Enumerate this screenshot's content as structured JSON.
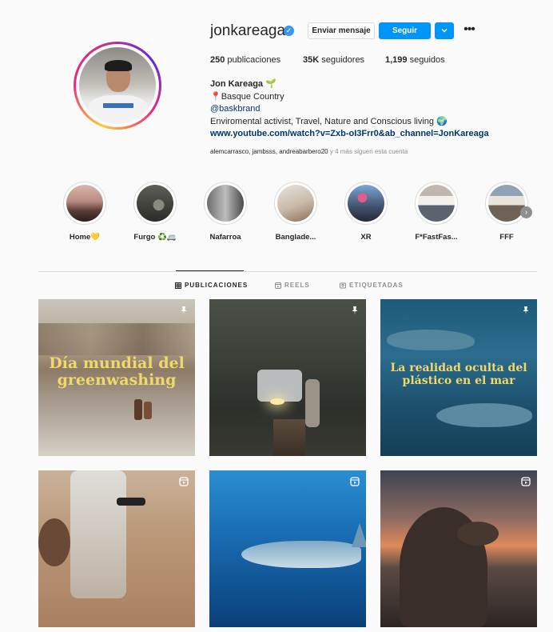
{
  "profile": {
    "username": "jonkareaga",
    "verified_mark": "✓",
    "message_label": "Enviar mensaje",
    "follow_label": "Seguir",
    "caret": "⌄",
    "more": "•••",
    "stats": {
      "posts_count": "250",
      "posts_label": " publicaciones",
      "followers_count": "35K",
      "followers_label": " seguidores",
      "following_count": "1,199",
      "following_label": " seguidos"
    },
    "bio": {
      "name": "Jon Kareaga",
      "name_emoji": "🌱",
      "location": "📍Basque Country",
      "brand": "@baskbrand",
      "description": "Enviromental activist, Travel, Nature and Conscious living 🌍",
      "link": "www.youtube.com/watch?v=Zxb-oI3Frr0&ab_channel=JonKareaga"
    },
    "followed_by": {
      "names": "alemcarrasco, jambsss, andreabarbero20",
      "suffix": " y 4 más siguen esta cuenta"
    }
  },
  "highlights": [
    {
      "label": "Home💛"
    },
    {
      "label": "Furgo ♻️🚐"
    },
    {
      "label": "Nafarroa"
    },
    {
      "label": "Banglade..."
    },
    {
      "label": "XR"
    },
    {
      "label": "F*FastFas..."
    },
    {
      "label": "FFF"
    }
  ],
  "highlights_next_arrow": "›",
  "tabs": {
    "posts": "PUBLICACIONES",
    "reels": "REELS",
    "tagged": "ETIQUETADAS"
  },
  "posts": [
    {
      "overlay": "Día mundial del greenwashing",
      "corner_icon": "pin-icon"
    },
    {
      "overlay": "",
      "corner_icon": "pin-icon"
    },
    {
      "overlay": "La realidad oculta del plástico en el mar",
      "corner_icon": "pin-icon"
    },
    {
      "overlay": "",
      "corner_icon": "reel-icon"
    },
    {
      "overlay": "",
      "corner_icon": "reel-icon"
    },
    {
      "overlay": "",
      "corner_icon": "reel-icon"
    }
  ],
  "colors": {
    "accent": "#0095f6",
    "link": "#00376b",
    "muted": "#8e8e8e"
  }
}
